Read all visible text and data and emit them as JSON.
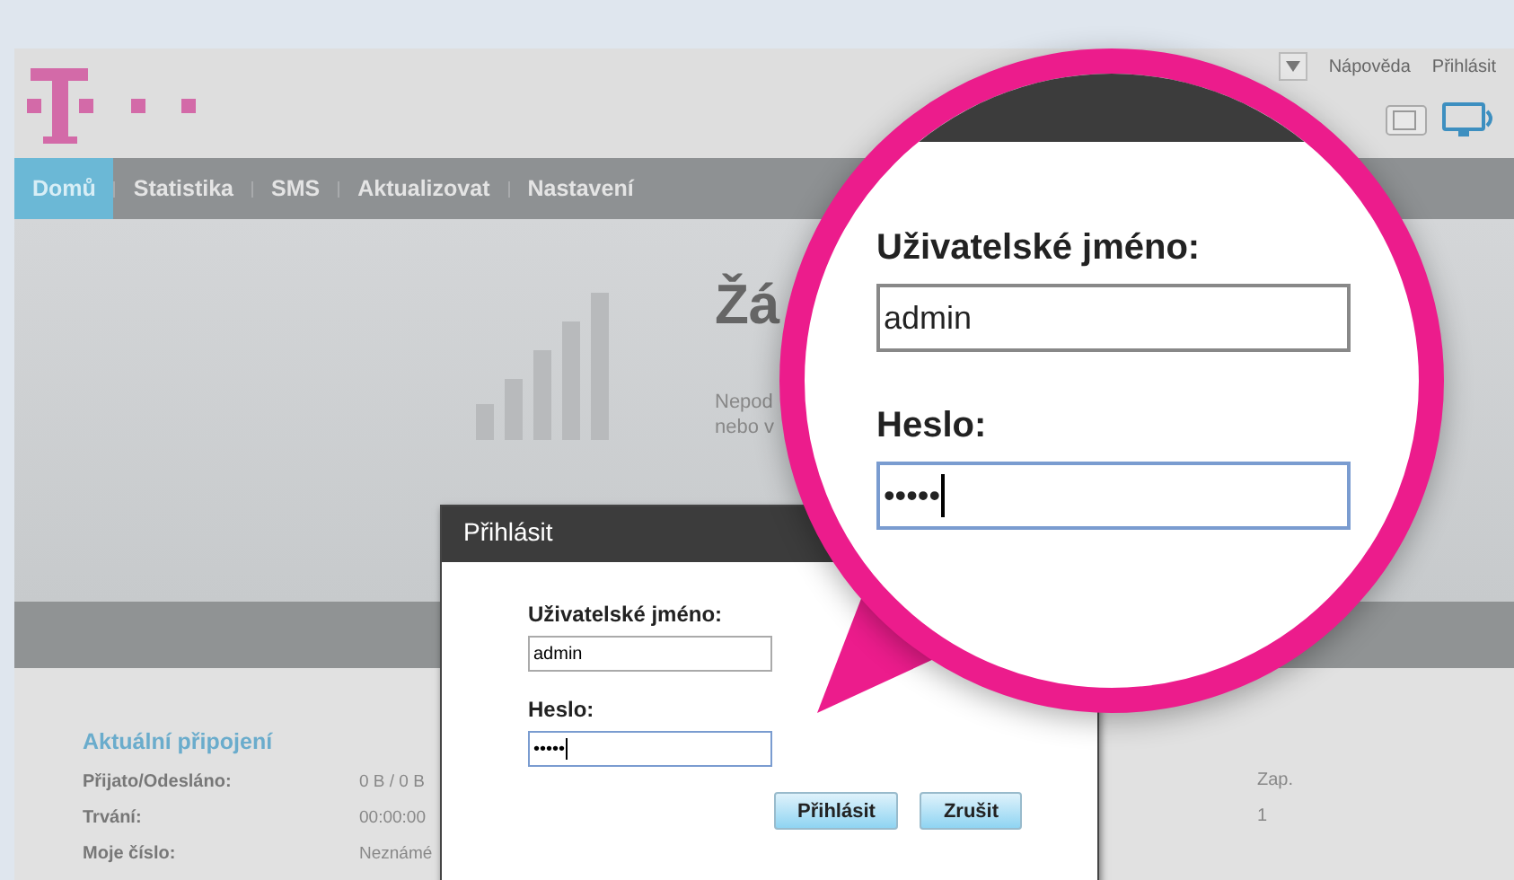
{
  "top_links": [
    "Nápověda",
    "Přihlásit"
  ],
  "nav": [
    {
      "label": "Domů",
      "selected": true
    },
    {
      "label": "Statistika",
      "selected": false
    },
    {
      "label": "SMS",
      "selected": false
    },
    {
      "label": "Aktualizovat",
      "selected": false
    },
    {
      "label": "Nastavení",
      "selected": false
    }
  ],
  "hero": {
    "title": "Žá",
    "text_lines": [
      "Nepod",
      "nebo v"
    ]
  },
  "connection": {
    "title": "Aktuální připojení",
    "rows": [
      {
        "label": "Přijato/Odesláno:",
        "value": "0 B / 0 B"
      },
      {
        "label": "Trvání:",
        "value": "00:00:00"
      },
      {
        "label": "Moje číslo:",
        "value": "Neznámé"
      }
    ],
    "right_values": [
      "Zap.",
      "1"
    ]
  },
  "dialog": {
    "title": "Přihlásit",
    "username_label": "Uživatelské jméno:",
    "username_value": "admin",
    "password_label": "Heslo:",
    "password_mask": "•••••",
    "password_focused": true,
    "buttons": [
      "Přihlásit",
      "Zrušit"
    ]
  },
  "magnifier": {
    "username_label": "Uživatelské jméno:",
    "username_value": "admin",
    "password_label": "Heslo:",
    "password_mask": "•••••",
    "password_focused": true
  }
}
